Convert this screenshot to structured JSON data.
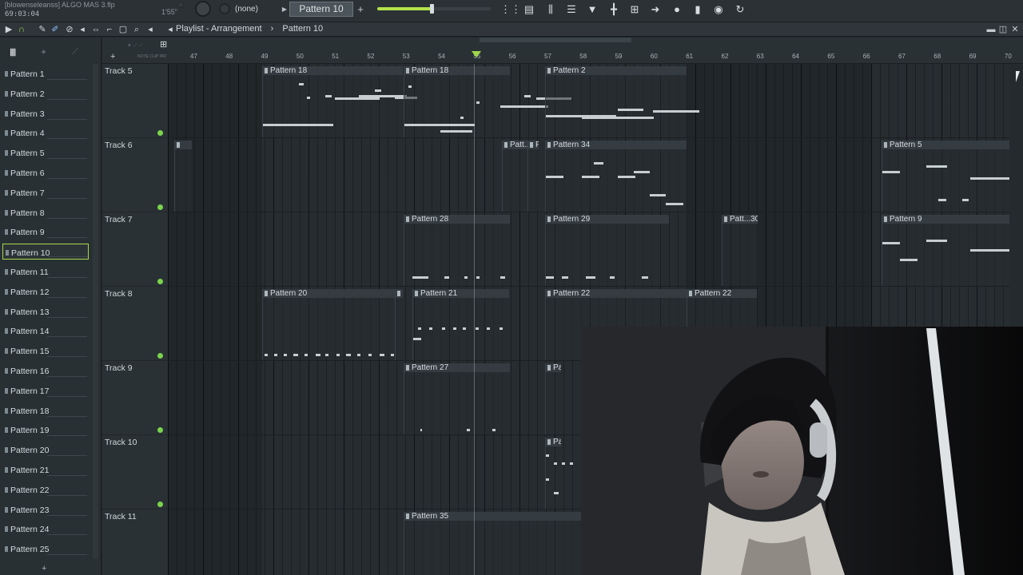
{
  "window": {
    "file_title": "[blowenseleanss] ALGO MAS 3.flp",
    "time": "69:03:04",
    "tempo": "1'55\""
  },
  "toolbar": {
    "snap_value": "(none)",
    "pattern_selector": "Pattern 10",
    "add_symbol": "+",
    "volume_fraction": 0.48,
    "icons": [
      "mixer-icon",
      "channel-rack-icon",
      "piano-roll-icon",
      "playlist-icon",
      "browser-icon",
      "plugin-picker-icon",
      "touch-keyboard-icon",
      "tempo-tapper-icon",
      "arrow-right-icon",
      "microphone-icon",
      "template-icon",
      "audio-icon",
      "undo-icon"
    ]
  },
  "playlist": {
    "title": "Playlist - Arrangement",
    "current_pattern": "Pattern 10",
    "tools": [
      "draw-tool-icon",
      "paint-tool-icon",
      "delete-tool-icon",
      "mute-tool-icon",
      "slip-tool-icon",
      "slice-tool-icon",
      "select-tool-icon",
      "zoom-tool-icon",
      "playback-tool-icon"
    ]
  },
  "picker": {
    "patterns": [
      "Pattern 1",
      "Pattern 2",
      "Pattern 3",
      "Pattern 4",
      "Pattern 5",
      "Pattern 6",
      "Pattern 7",
      "Pattern 8",
      "Pattern 9",
      "Pattern 10",
      "Pattern 11",
      "Pattern 12",
      "Pattern 13",
      "Pattern 14",
      "Pattern 15",
      "Pattern 16",
      "Pattern 17",
      "Pattern 18",
      "Pattern 19",
      "Pattern 20",
      "Pattern 21",
      "Pattern 22",
      "Pattern 23",
      "Pattern 24",
      "Pattern 25"
    ],
    "selected": "Pattern 10"
  },
  "ruler": {
    "bars": [
      "47",
      "48",
      "49",
      "50",
      "51",
      "52",
      "53",
      "54",
      "55",
      "56",
      "57",
      "58",
      "59",
      "60",
      "61",
      "62",
      "63",
      "64",
      "65",
      "66",
      "67",
      "68",
      "69",
      "70"
    ],
    "playhead_bar": "55"
  },
  "tracks": [
    "Track 5",
    "Track 6",
    "Track 7",
    "Track 8",
    "Track 9",
    "Track 10",
    "Track 11"
  ],
  "clips": [
    {
      "track": 0,
      "label": "Pattern 18"
    },
    {
      "track": 0,
      "label": "Pattern 18"
    },
    {
      "track": 0,
      "label": "Pattern 2"
    },
    {
      "track": 1,
      "label": ""
    },
    {
      "track": 1,
      "label": "Patt..."
    },
    {
      "track": 1,
      "label": "P..."
    },
    {
      "track": 1,
      "label": "Pattern 34"
    },
    {
      "track": 1,
      "label": "Pattern 5"
    },
    {
      "track": 2,
      "label": "Pattern 28"
    },
    {
      "track": 2,
      "label": "Pattern 29"
    },
    {
      "track": 2,
      "label": "Patt...30"
    },
    {
      "track": 2,
      "label": "Pattern 9"
    },
    {
      "track": 3,
      "label": "Pattern 20"
    },
    {
      "track": 3,
      "label": ""
    },
    {
      "track": 3,
      "label": "Pattern 21"
    },
    {
      "track": 3,
      "label": "Pattern 22"
    },
    {
      "track": 3,
      "label": "Pattern 22"
    },
    {
      "track": 4,
      "label": "Pattern 27"
    },
    {
      "track": 4,
      "label": "Pattern"
    },
    {
      "track": 5,
      "label": "Pattern"
    },
    {
      "track": 6,
      "label": "Pattern 35"
    }
  ],
  "webcam": {
    "description_icon": "webcam-feed"
  }
}
